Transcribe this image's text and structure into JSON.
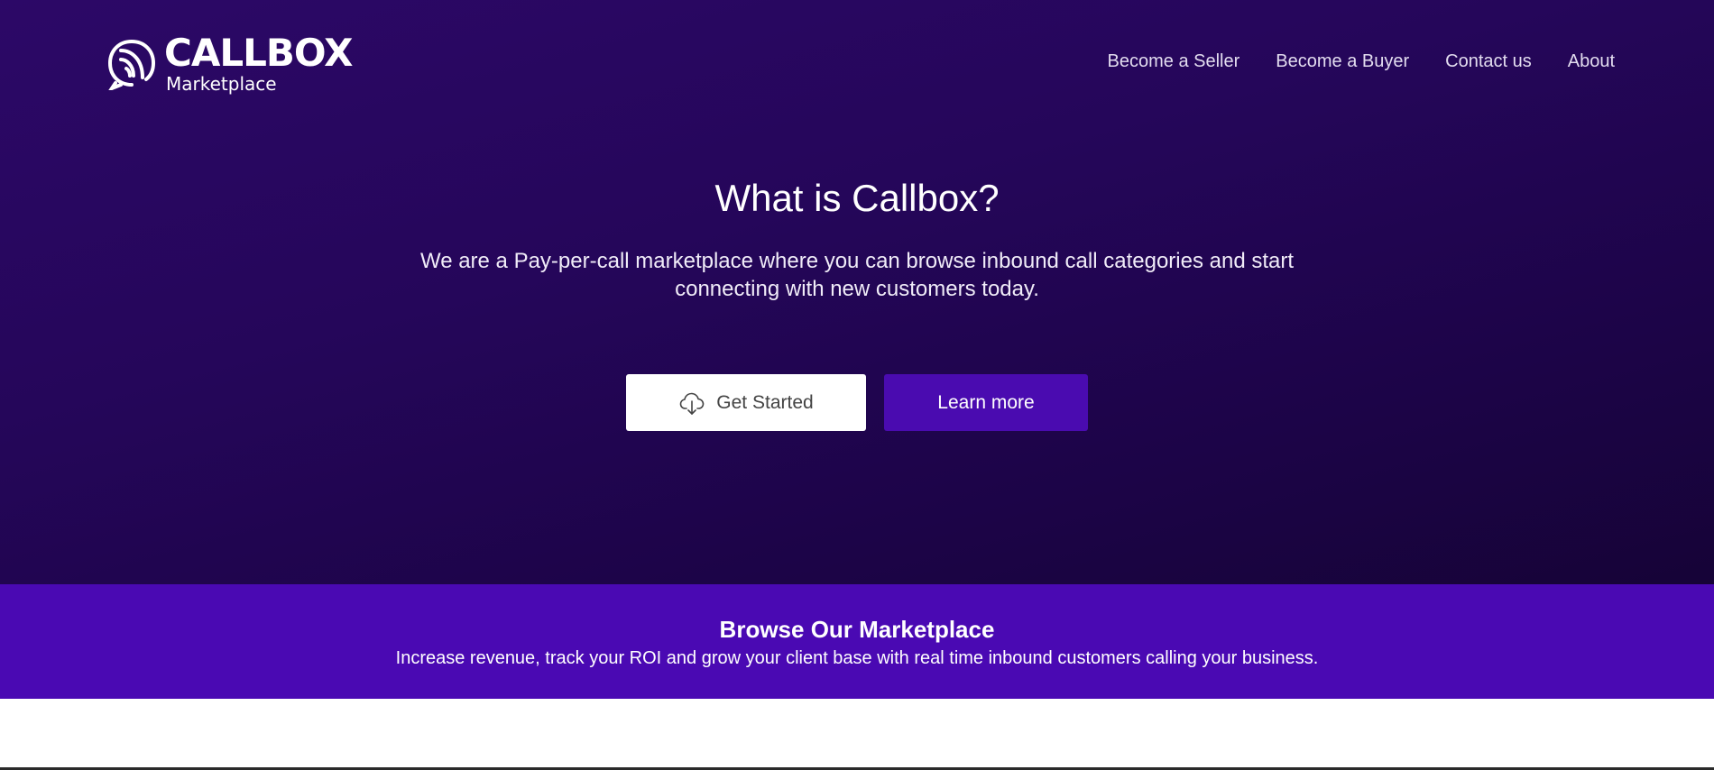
{
  "header": {
    "logo_title": "CALLBOX",
    "logo_subtitle": "Marketplace",
    "logo_icon": "callbox-logo-icon",
    "nav": [
      {
        "label": "Become a Seller"
      },
      {
        "label": "Become a Buyer"
      },
      {
        "label": "Contact us"
      },
      {
        "label": "About"
      }
    ]
  },
  "hero": {
    "title": "What is Callbox?",
    "description": "We are a Pay-per-call marketplace where you can browse inbound call categories and start connecting with new customers today.",
    "primary_button": {
      "label": "Get Started",
      "icon": "cloud-download-icon"
    },
    "secondary_button": {
      "label": "Learn more"
    }
  },
  "browse": {
    "title": "Browse Our Marketplace",
    "description": "Increase revenue, track your ROI and grow your client base with real time inbound customers calling your business."
  },
  "colors": {
    "hero_gradient_start": "#2c0867",
    "hero_gradient_end": "#160337",
    "accent": "#4a09b3",
    "button_secondary": "#4a0bb0"
  }
}
